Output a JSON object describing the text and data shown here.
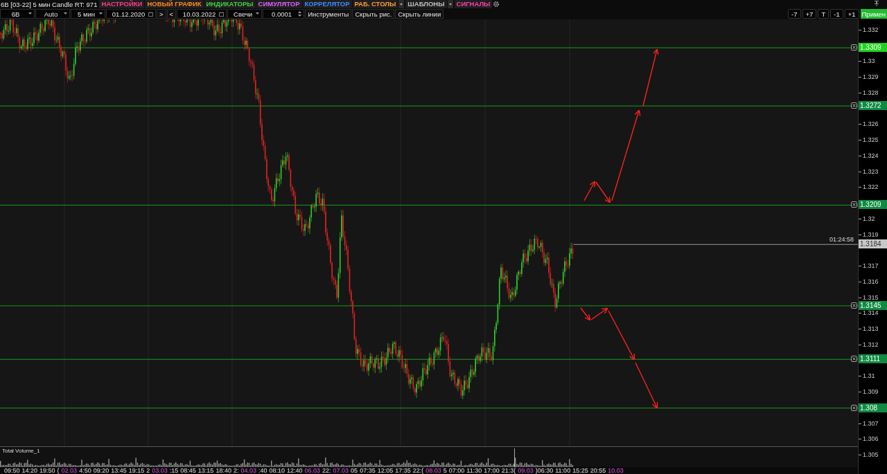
{
  "header": {
    "title": "6B [03-22] 5 мин Candle RT: 971",
    "menu": [
      {
        "label": "НАСТРОЙКИ",
        "color": "#ff3c8c",
        "kind": "button"
      },
      {
        "label": "НОВЫЙ ГРАФИК",
        "color": "#ff8a1c",
        "kind": "button"
      },
      {
        "label": "ИНДИКАТОРЫ",
        "color": "#3fd13f",
        "kind": "button"
      },
      {
        "label": "СИМУЛЯТОР",
        "color": "#e060ff",
        "kind": "button"
      },
      {
        "label": "КОРРЕЛЯТОР",
        "color": "#3c8cff",
        "kind": "button"
      },
      {
        "label": "РАБ. СТОЛЫ",
        "color": "#ffa030",
        "kind": "dropdown"
      },
      {
        "label": "ШАБЛОНЫ",
        "color": "#c0c0c0",
        "kind": "dropdown"
      },
      {
        "label": "СИГНАЛЫ",
        "color": "#ff3cb0",
        "kind": "button"
      }
    ]
  },
  "toolbar": {
    "controls": [
      {
        "kind": "select",
        "value": "6B"
      },
      {
        "kind": "select",
        "value": "Auto"
      },
      {
        "kind": "select",
        "value": "5 мин"
      },
      {
        "kind": "date",
        "value": "01.12.2020"
      },
      {
        "kind": "button",
        "label": ">"
      },
      {
        "kind": "button",
        "label": "<"
      },
      {
        "kind": "date",
        "value": "10.03.2022"
      },
      {
        "kind": "select",
        "value": "Свечи"
      },
      {
        "kind": "spinner",
        "value": "0.0001"
      },
      {
        "kind": "button",
        "label": "Инструменты"
      },
      {
        "kind": "button",
        "label": "Скрыть рис."
      },
      {
        "kind": "button",
        "label": "Скрыть линии"
      }
    ],
    "right_buttons": [
      {
        "label": "-7",
        "kind": "button"
      },
      {
        "label": "+7",
        "kind": "button"
      },
      {
        "label": "T",
        "kind": "button"
      },
      {
        "label": "-1",
        "kind": "button"
      },
      {
        "label": "+1",
        "kind": "button"
      },
      {
        "label": "Примен",
        "kind": "apply"
      }
    ]
  },
  "price_axis": {
    "ticks": [
      "1.332",
      "1.33",
      "1.329",
      "1.328",
      "1.326",
      "1.325",
      "1.324",
      "1.323",
      "1.322",
      "1.32",
      "1.319",
      "1.317",
      "1.316",
      "1.315",
      "1.314",
      "1.313",
      "1.312",
      "1.31",
      "1.309",
      "1.307",
      "1.306",
      "1.305"
    ]
  },
  "levels": [
    {
      "price": "1.3309",
      "color": "#1fd11f"
    },
    {
      "price": "1.3272",
      "color": "#0f8a42"
    },
    {
      "price": "1.3209",
      "color": "#0f8a42"
    },
    {
      "price": "1.3145",
      "color": "#0f8a42"
    },
    {
      "price": "1.3111",
      "color": "#0f8a42"
    },
    {
      "price": "1.308",
      "color": "#0f8a42"
    }
  ],
  "current_price": {
    "price": "1.3184",
    "timer": "01:24:58"
  },
  "volume_pane": {
    "title": "Total Volume_1"
  },
  "time_axis": [
    {
      "text": "09:50",
      "kind": "time"
    },
    {
      "text": "14:20",
      "kind": "time"
    },
    {
      "text": "19:50",
      "kind": "time"
    },
    {
      "text": "(",
      "kind": "time"
    },
    {
      "text": "02.03",
      "kind": "date"
    },
    {
      "text": "4:50",
      "kind": "time"
    },
    {
      "text": "09:20",
      "kind": "time"
    },
    {
      "text": "13:45",
      "kind": "time"
    },
    {
      "text": "19:15",
      "kind": "time"
    },
    {
      "text": "2",
      "kind": "time"
    },
    {
      "text": "03.03",
      "kind": "date"
    },
    {
      "text": ":15",
      "kind": "time"
    },
    {
      "text": "08:45",
      "kind": "time"
    },
    {
      "text": "13:15",
      "kind": "time"
    },
    {
      "text": "18:40",
      "kind": "time"
    },
    {
      "text": "2:",
      "kind": "time"
    },
    {
      "text": "04.03",
      "kind": "date"
    },
    {
      "text": ":40",
      "kind": "time"
    },
    {
      "text": "08:10",
      "kind": "time"
    },
    {
      "text": "12:40",
      "kind": "time"
    },
    {
      "text": "06.03",
      "kind": "date"
    },
    {
      "text": "22:",
      "kind": "time"
    },
    {
      "text": "07.03",
      "kind": "date"
    },
    {
      "text": "05",
      "kind": "time"
    },
    {
      "text": "07:35",
      "kind": "time"
    },
    {
      "text": "12:05",
      "kind": "time"
    },
    {
      "text": "17:35",
      "kind": "time"
    },
    {
      "text": "22:(",
      "kind": "time"
    },
    {
      "text": "08.03",
      "kind": "date"
    },
    {
      "text": "5",
      "kind": "time"
    },
    {
      "text": "07:00",
      "kind": "time"
    },
    {
      "text": "11:30",
      "kind": "time"
    },
    {
      "text": "17:00",
      "kind": "time"
    },
    {
      "text": "21:3(",
      "kind": "time"
    },
    {
      "text": "09.03",
      "kind": "date"
    },
    {
      "text": ")06:30",
      "kind": "time"
    },
    {
      "text": "11:00",
      "kind": "time"
    },
    {
      "text": "15:25",
      "kind": "time"
    },
    {
      "text": "20:55",
      "kind": "time"
    },
    {
      "text": "10.03",
      "kind": "date"
    }
  ]
}
